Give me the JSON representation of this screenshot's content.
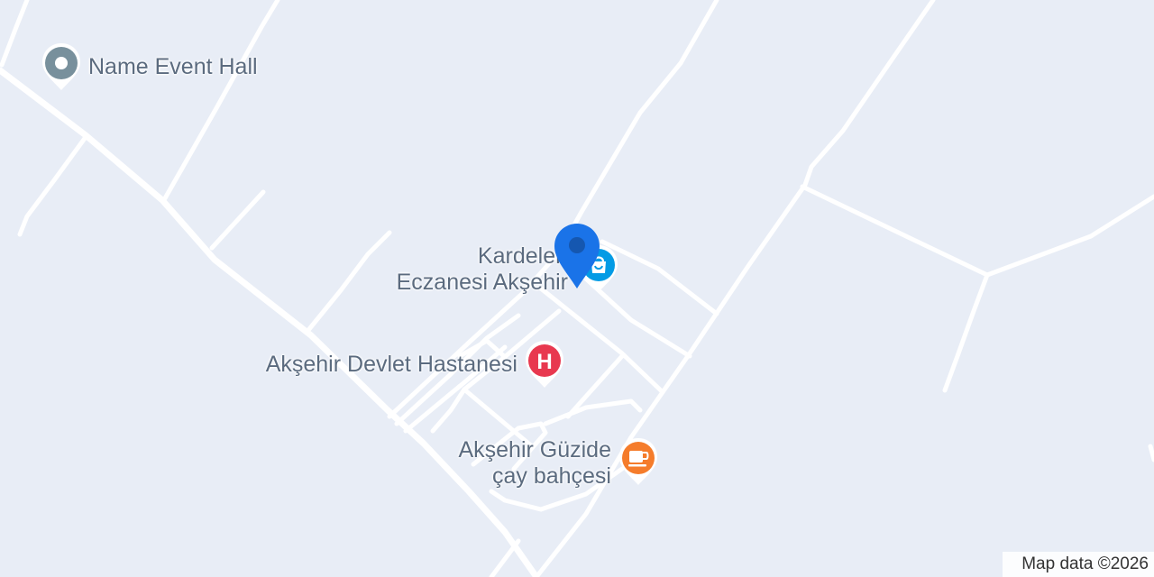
{
  "map": {
    "background_color": "#e8edf6",
    "road_color": "#ffffff"
  },
  "pois": [
    {
      "name": "Name Event Hall",
      "category": "generic",
      "icon": "place-pin-icon",
      "color": "#78909c"
    },
    {
      "name_line1": "Kardelen",
      "name_line2": "Eczanesi Akşehir",
      "category": "pharmacy",
      "icon": "shopping-bag-icon",
      "color": "#039be5"
    },
    {
      "name": "Akşehir Devlet Hastanesi",
      "category": "hospital",
      "icon": "hospital-icon",
      "icon_letter": "H",
      "color": "#e8384f"
    },
    {
      "name_line1": "Akşehir Güzide",
      "name_line2": "çay bahçesi",
      "category": "cafe",
      "icon": "coffee-cup-icon",
      "color": "#f57c2b"
    }
  ],
  "current_location": {
    "icon": "location-pin-icon",
    "color": "#1a73e8"
  },
  "attribution": "Map data ©2026"
}
